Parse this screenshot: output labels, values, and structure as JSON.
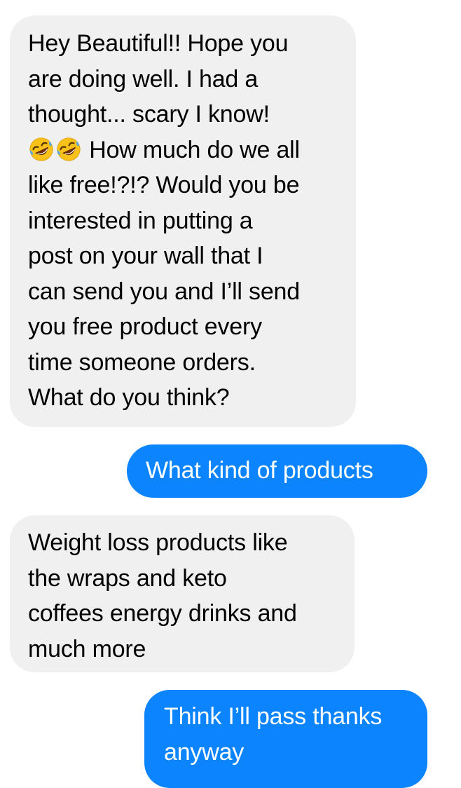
{
  "conversation": {
    "messages": [
      {
        "direction": "incoming",
        "text_before_emoji": "Hey Beautiful!! Hope you\nare doing well. I had a\nthought... scary I know!\n",
        "emojis": [
          "rolling-on-the-floor-laughing-icon",
          "rolling-on-the-floor-laughing-icon"
        ],
        "text_after_emoji": " How much do we all\nlike free!?!? Would you be\ninterested in putting a\npost on your wall that I\ncan send you and I’ll send\nyou free product every\ntime someone orders.\nWhat do you think?"
      },
      {
        "direction": "outgoing",
        "text": "What kind of products"
      },
      {
        "direction": "incoming",
        "text": "Weight loss products like\nthe wraps and keto\ncoffees energy drinks and\nmuch more"
      },
      {
        "direction": "outgoing",
        "text": "Think I’ll pass thanks\nanyway"
      }
    ]
  },
  "colors": {
    "incoming_bubble": "#f0f0f0",
    "incoming_text": "#000000",
    "outgoing_bubble": "#0b84fe",
    "outgoing_text": "#ffffff",
    "emoji_face": "#f9c21a",
    "emoji_tears": "#5aa9e6"
  }
}
